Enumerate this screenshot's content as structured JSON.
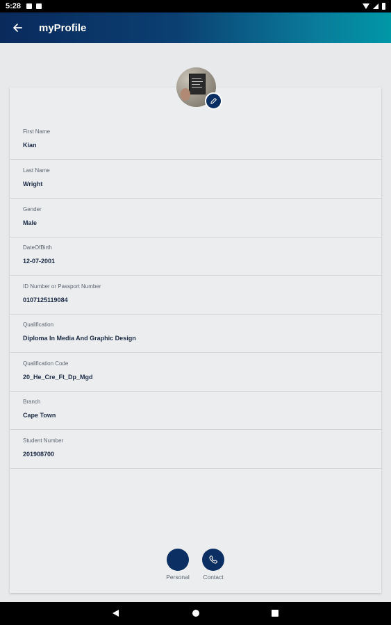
{
  "status_bar": {
    "time": "5:28"
  },
  "app_bar": {
    "title": "myProfile"
  },
  "fields": [
    {
      "label": "First Name",
      "value": "Kian"
    },
    {
      "label": "Last Name",
      "value": "Wright"
    },
    {
      "label": "Gender",
      "value": "Male"
    },
    {
      "label": "DateOfBirth",
      "value": "12-07-2001"
    },
    {
      "label": "ID Number or Passport Number",
      "value": "0107125119084"
    },
    {
      "label": "Qualification",
      "value": "Diploma In Media And Graphic Design"
    },
    {
      "label": "Qualification Code",
      "value": "20_He_Cre_Ft_Dp_Mgd"
    },
    {
      "label": "Branch",
      "value": "Cape Town"
    },
    {
      "label": "Student Number",
      "value": "201908700"
    }
  ],
  "bottom_nav": [
    {
      "label": "Personal",
      "icon": "person-icon"
    },
    {
      "label": "Contact",
      "icon": "phone-icon"
    }
  ],
  "colors": {
    "primary": "#0b2f63",
    "accent": "#0097a7",
    "background": "#e8e9eb"
  }
}
